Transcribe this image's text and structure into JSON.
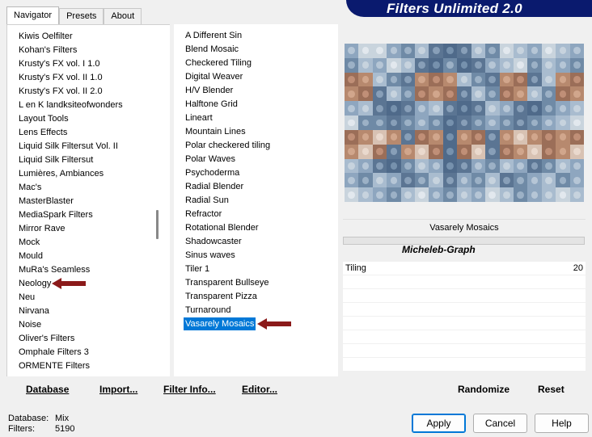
{
  "title": "Filters Unlimited 2.0",
  "tabs": [
    {
      "label": "Navigator",
      "active": true
    },
    {
      "label": "Presets",
      "active": false
    },
    {
      "label": "About",
      "active": false
    }
  ],
  "categories": [
    "Kiwis Oelfilter",
    "Kohan's Filters",
    "Krusty's FX vol. I 1.0",
    "Krusty's FX vol. II 1.0",
    "Krusty's FX vol. II 2.0",
    "L en K landksiteofwonders",
    "Layout Tools",
    "Lens Effects",
    "Liquid Silk Filtersut Vol. II",
    "Liquid Silk Filtersut",
    "Lumières, Ambiances",
    "Mac's",
    "MasterBlaster",
    "MediaSpark Filters",
    "Mirror Rave",
    "Mock",
    "Mould",
    "MuRa's Seamless",
    "Neology",
    "Neu",
    "Nirvana",
    "Noise",
    "Oliver's Filters",
    "Omphale Filters 3",
    "ORMENTE Filters"
  ],
  "selected_category": "Neology",
  "filters": [
    "A Different Sin",
    "Blend Mosaic",
    "Checkered Tiling",
    "Digital Weaver",
    "H/V Blender",
    "Halftone Grid",
    "Lineart",
    "Mountain Lines",
    "Polar checkered tiling",
    "Polar Waves",
    "Psychoderma",
    "Radial Blender",
    "Radial Sun",
    "Refractor",
    "Rotational Blender",
    "Shadowcaster",
    "Sinus waves",
    "Tiler 1",
    "Transparent Bullseye",
    "Transparent Pizza",
    "Turnaround",
    "Vasarely Mosaics"
  ],
  "selected_filter": "Vasarely Mosaics",
  "preview": {
    "filter_name": "Vasarely Mosaics",
    "author": "Micheleb-Graph",
    "params": [
      {
        "label": "Tiling",
        "value": "20"
      }
    ]
  },
  "toolbar": {
    "database": "Database",
    "import": "Import...",
    "filter_info": "Filter Info...",
    "editor": "Editor...",
    "randomize": "Randomize",
    "reset": "Reset"
  },
  "status": {
    "database_label": "Database:",
    "database_value": "Mix",
    "filters_label": "Filters:",
    "filters_value": "5190"
  },
  "buttons": {
    "apply": "Apply",
    "cancel": "Cancel",
    "help": "Help"
  },
  "colors": {
    "title_banner": "#0a1a6e",
    "selection": "#0078d7",
    "arrow": "#8b1a1a"
  }
}
